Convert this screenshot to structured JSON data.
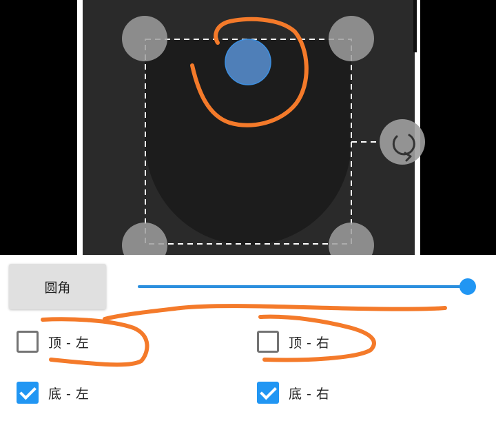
{
  "editor": {
    "rotate_icon": "rotate-icon",
    "handle_color": "#9e9e9e",
    "center_handle_color": "#4a7ab0",
    "selection_border_color": "#ffffff"
  },
  "controls": {
    "corner_button_label": "圆角",
    "radius_slider": {
      "value": 1.0,
      "color": "#2196f3"
    },
    "checkboxes": [
      {
        "label": "顶 - 左",
        "checked": false
      },
      {
        "label": "顶 - 右",
        "checked": false
      },
      {
        "label": "底 - 左",
        "checked": true
      },
      {
        "label": "底 - 右",
        "checked": true
      }
    ]
  },
  "annotation_color": "#f47a2a"
}
